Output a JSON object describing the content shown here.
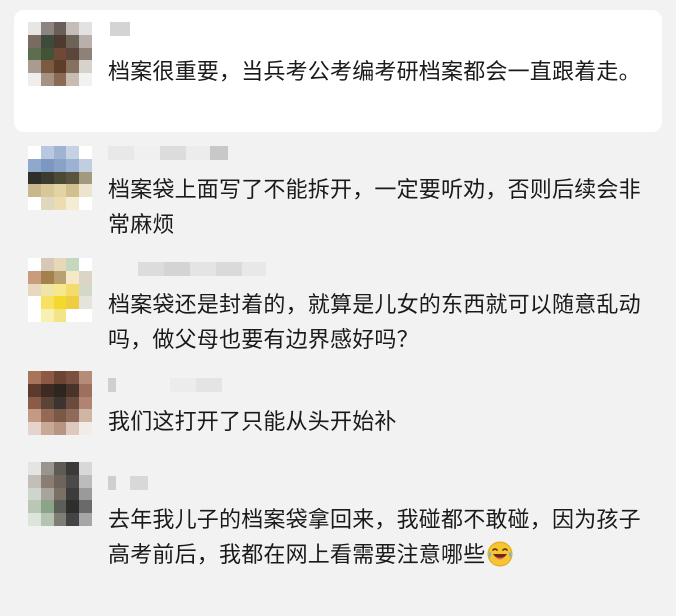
{
  "comments": [
    {
      "text": "档案很重要，当兵考公考编考研档案都会一直跟着走。",
      "avatar_colors": [
        "#e8e6e4",
        "#8c8480",
        "#6a5e58",
        "#c4bcb8",
        "#e4e2e0",
        "#7a6a60",
        "#3e4a3a",
        "#4f3a30",
        "#6d6258",
        "#b9b0ab",
        "#5c6e4e",
        "#445236",
        "#6e4a36",
        "#5a463a",
        "#8e8278",
        "#a89c90",
        "#7c5a40",
        "#5e3e2a",
        "#86705e",
        "#d8d2cc",
        "#f0eeec",
        "#a49284",
        "#8a6a52",
        "#c8bcb2",
        "#f2f2f2"
      ]
    },
    {
      "text": "档案袋上面写了不能拆开，一定要听劝，否则后续会非常麻烦",
      "avatar_colors": [
        "#ffffff",
        "#b8c8de",
        "#9fb4d2",
        "#c6d2e2",
        "#ffffff",
        "#8fa8cc",
        "#7c98c2",
        "#88a2c8",
        "#9cb2d2",
        "#c0cee0",
        "#2e2e2a",
        "#3a3a2e",
        "#4c4a36",
        "#585440",
        "#a29a7e",
        "#c8b88c",
        "#d8c898",
        "#e4d4a4",
        "#d0c090",
        "#ece4cc",
        "#ffffff",
        "#e0d8bc",
        "#ecdcb0",
        "#f4ecd4",
        "#ffffff"
      ]
    },
    {
      "text": "档案袋还是封着的，就算是儿女的东西就可以随意乱动吗，做父母也要有边界感好吗？",
      "avatar_colors": [
        "#ffffff",
        "#d8c8b8",
        "#e8d8b8",
        "#c4d8c0",
        "#ffffff",
        "#c89c7c",
        "#a4804c",
        "#b8a070",
        "#f4e8c8",
        "#dcd4c4",
        "#e8d8c0",
        "#f0e4a8",
        "#f8e88c",
        "#f4dc6c",
        "#d4d8c8",
        "#ffffff",
        "#f8e060",
        "#f4d830",
        "#f0cc40",
        "#e4e4dc",
        "#ffffff",
        "#f8f0b0",
        "#f4e488",
        "#ffffff",
        "#ffffff"
      ]
    },
    {
      "text": "我们这打开了只能从头开始补",
      "avatar_colors": [
        "#a8745c",
        "#8c5a44",
        "#6c4434",
        "#7c5040",
        "#b48c78",
        "#5c3a2c",
        "#3e2a22",
        "#2e2420",
        "#4a342a",
        "#9c705c",
        "#8a5c48",
        "#5a4438",
        "#3c3430",
        "#6a4c3e",
        "#b08470",
        "#c49a84",
        "#946a56",
        "#7a5848",
        "#8e6a58",
        "#d0b4a4",
        "#e4d4cc",
        "#c8a896",
        "#b89484",
        "#dcc8bc",
        "#f2ece8"
      ]
    },
    {
      "text": "去年我儿子的档案袋拿回来，我碰都不敢碰，因为孩子高考前后，我都在网上看需要注意哪些",
      "avatar_colors": [
        "#e4e4e4",
        "#9a948e",
        "#5e5a56",
        "#3a3a3a",
        "#d8d8d8",
        "#c4beb8",
        "#8a7e74",
        "#6e645c",
        "#4c4a48",
        "#bcbcbc",
        "#cfd4cc",
        "#a8a49c",
        "#7a7064",
        "#3c3c3a",
        "#9a9a9a",
        "#b8c8b4",
        "#8aa488",
        "#5e5e58",
        "#2e2e2e",
        "#6a6a6a",
        "#dde4da",
        "#b4c4b0",
        "#7e7e76",
        "#444444",
        "#a6a6a6"
      ],
      "emoji": "😂"
    }
  ]
}
